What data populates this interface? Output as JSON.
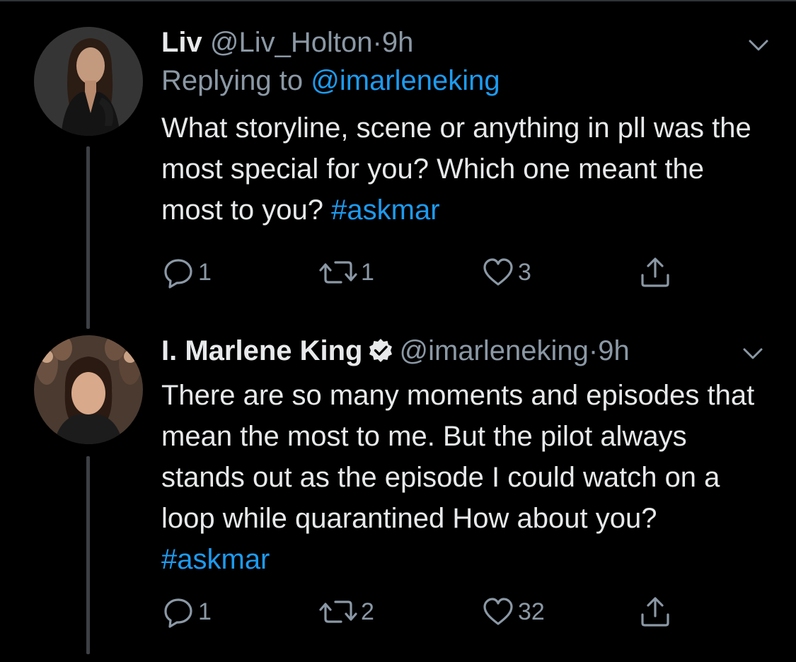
{
  "tweets": [
    {
      "name": "Liv",
      "handle": "@Liv_Holton",
      "separator": "·",
      "time": "9h",
      "replying_prefix": "Replying to",
      "replying_to": "@imarleneking",
      "text": "What storyline, scene or anything in pll was the most special for you? Which one meant the most to you?",
      "hashtag": "#askmar",
      "stats": {
        "replies": "1",
        "retweets": "1",
        "likes": "3"
      }
    },
    {
      "name": "I. Marlene King",
      "handle": "@imarleneking",
      "separator": "·",
      "time": "9h",
      "verified": true,
      "text": "There are so many moments and episodes that mean the most to me.  But the pilot always stands out as the episode I could watch on a loop while quarantined How about you?",
      "hashtag": "#askmar",
      "stats": {
        "replies": "1",
        "retweets": "2",
        "likes": "32"
      }
    }
  ],
  "colors": {
    "background": "#000000",
    "primary_text": "#e7e9ea",
    "secondary_text": "#8b98a5",
    "accent": "#1d9bf0",
    "thread_line": "#3d4146"
  }
}
